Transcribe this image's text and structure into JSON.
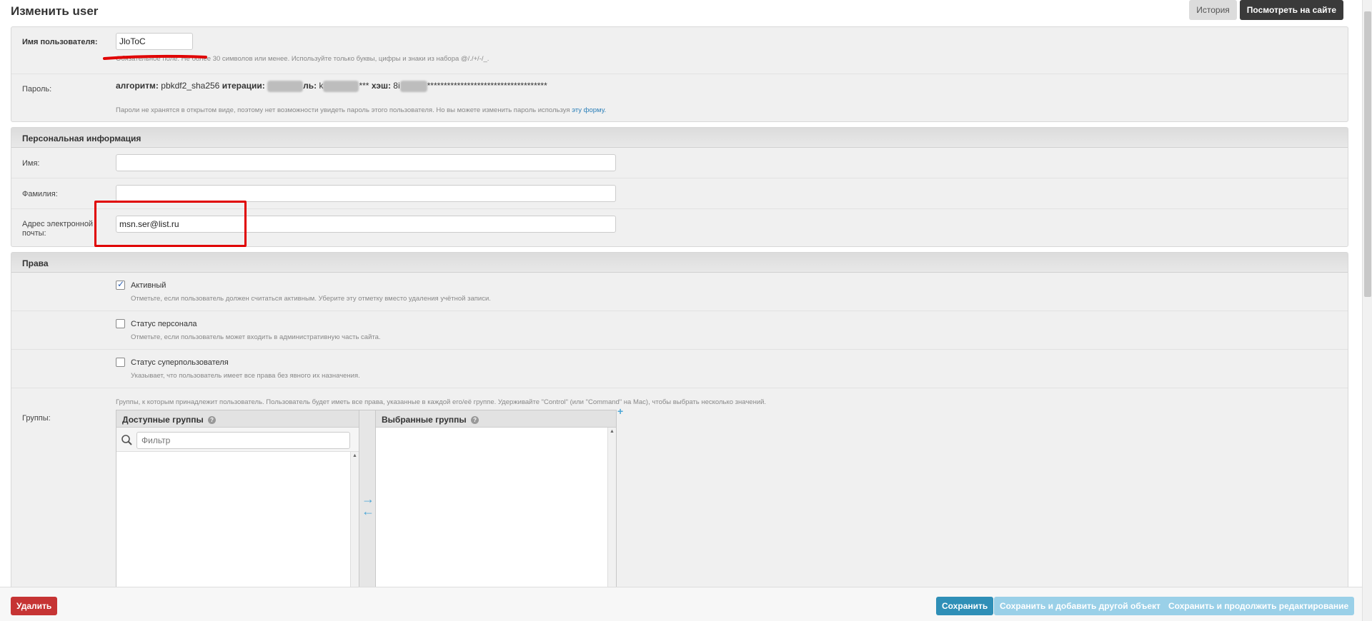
{
  "header": {
    "title": "Изменить user",
    "history_button": "История",
    "view_on_site_button": "Посмотреть на сайте"
  },
  "account": {
    "username_label": "Имя пользователя:",
    "username_value": "JloToC",
    "username_help": "Обязательное поле. Не более 30 символов или менее. Используйте только буквы, цифры и знаки из набора @/./+/-/_.",
    "password_label": "Пароль:",
    "password_algorithm_label": "алгоритм:",
    "password_algorithm_value": "pbkdf2_sha256",
    "password_iterations_label": "итерации:",
    "password_salt_label": "ль:",
    "password_salt_value": "k",
    "password_salt_tail": "***",
    "password_hash_label": "хэш:",
    "password_hash_value": "8i",
    "password_hash_tail": "************************************",
    "password_help": "Пароли не хранятся в открытом виде, поэтому нет возможности увидеть пароль этого пользователя. Но вы можете изменить пароль используя",
    "password_help_link": "эту форму."
  },
  "personal": {
    "heading": "Персональная информация",
    "first_name_label": "Имя:",
    "first_name_value": "",
    "last_name_label": "Фамилия:",
    "last_name_value": "",
    "email_label": "Адрес электронной почты:",
    "email_value": "msn.ser@list.ru"
  },
  "permissions": {
    "heading": "Права",
    "active": {
      "label": "Активный",
      "checked": true,
      "help": "Отметьте, если пользователь должен считаться активным. Уберите эту отметку вместо удаления учётной записи."
    },
    "staff": {
      "label": "Статус персонала",
      "checked": false,
      "help": "Отметьте, если пользователь может входить в административную часть сайта."
    },
    "superuser": {
      "label": "Статус суперпользователя",
      "checked": false,
      "help": "Указывает, что пользователь имеет все права без явного их назначения."
    },
    "groups_label": "Группы:",
    "groups_help": "Группы, к которым принадлежит пользователь. Пользователь будет иметь все права, указанные в каждой его/её группе. Удерживайте \"Control\" (или \"Command\" на Mac), чтобы выбрать несколько значений.",
    "available_groups_title": "Доступные группы",
    "chosen_groups_title": "Выбранные группы",
    "filter_placeholder": "Фильтр",
    "add_icon": "plus-icon"
  },
  "footer": {
    "delete_button": "Удалить",
    "save_button": "Сохранить",
    "save_add_button": "Сохранить и добавить другой объект",
    "save_continue_button": "Сохранить и продолжить редактирование"
  },
  "annotations": {
    "underline_color": "#e00000",
    "box_color": "#e00000"
  }
}
